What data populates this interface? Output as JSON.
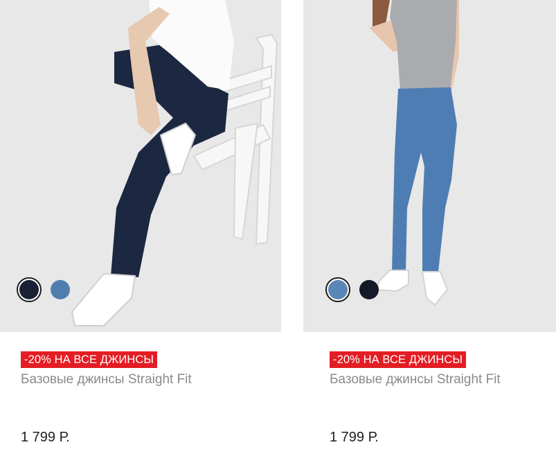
{
  "products": [
    {
      "promo": "-20% НА ВСЕ ДЖИНСЫ",
      "title": "Базовые джинсы Straight Fit",
      "price": "1 799 Р.",
      "swatches": [
        {
          "color": "#1a2236",
          "selected": true
        },
        {
          "color": "#4f7eae",
          "selected": false
        }
      ]
    },
    {
      "promo": "-20% НА ВСЕ ДЖИНСЫ",
      "title": "Базовые джинсы Straight Fit",
      "price": "1 799 Р.",
      "swatches": [
        {
          "color": "#5b86b8",
          "selected": true
        },
        {
          "color": "#151a28",
          "selected": false
        }
      ]
    }
  ]
}
